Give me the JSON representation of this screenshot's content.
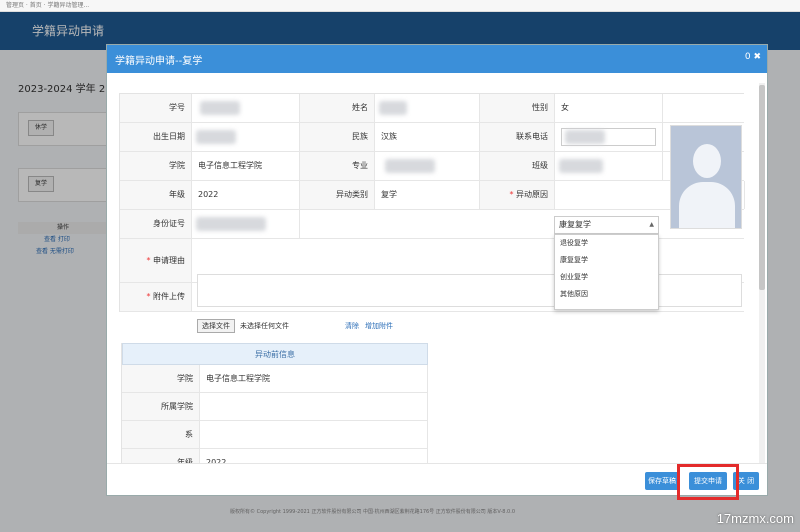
{
  "browser": {
    "tab_text": "管理页 · 首页 · 学籍异动管理..."
  },
  "app": {
    "title": "学籍异动申请"
  },
  "background": {
    "year_text": "2023-2024 学年 2 学",
    "btn_xiuxue": "休学",
    "btn_fuxue": "复学",
    "table_header": "操作",
    "row1": "查看  打印",
    "row2": "查看  无需打印",
    "footer": "版权所有© Copyright 1999-2021 正方软件股份有限公司    中国·杭州西湖区紫荆花路176号 正方软件股份有限公司    版本V-8.0.0"
  },
  "modal": {
    "title": "学籍异动申请--复学",
    "close_label": "0 ✖",
    "fields": {
      "xuehao_label": "学号",
      "xingming_label": "姓名",
      "xingbie_label": "性别",
      "xingbie_value": "女",
      "birth_label": "出生日期",
      "minzu_label": "民族",
      "minzu_value": "汉族",
      "phone_label": "联系电话",
      "xueyuan_label": "学院",
      "xueyuan_value": "电子信息工程学院",
      "zhuanye_label": "专业",
      "banji_label": "班级",
      "nianji_label": "年级",
      "nianji_value": "2022",
      "yidong_type_label": "异动类别",
      "yidong_type_value": "复学",
      "yidong_reason_label": "异动原因",
      "idcard_label": "身份证号",
      "reason_label": "申请理由",
      "attach_label": "附件上传",
      "required_mark": "*"
    },
    "select": {
      "selected": "康复复学",
      "options": [
        "退役复学",
        "康复复学",
        "创业复学",
        "其他原因"
      ]
    },
    "file": {
      "button": "选择文件",
      "status": "未选择任何文件",
      "clear_link": "清除",
      "add_link": "增加附件"
    },
    "before": {
      "header": "异动前信息",
      "rows": [
        {
          "label": "学院",
          "value": "电子信息工程学院"
        },
        {
          "label": "所属学院",
          "value": ""
        },
        {
          "label": "系",
          "value": ""
        },
        {
          "label": "年级",
          "value": "2022"
        }
      ]
    },
    "footer": {
      "save_draft": "保存草稿",
      "submit": "提交申请",
      "close": "关 闭"
    }
  },
  "watermark": "17mzmx.com"
}
